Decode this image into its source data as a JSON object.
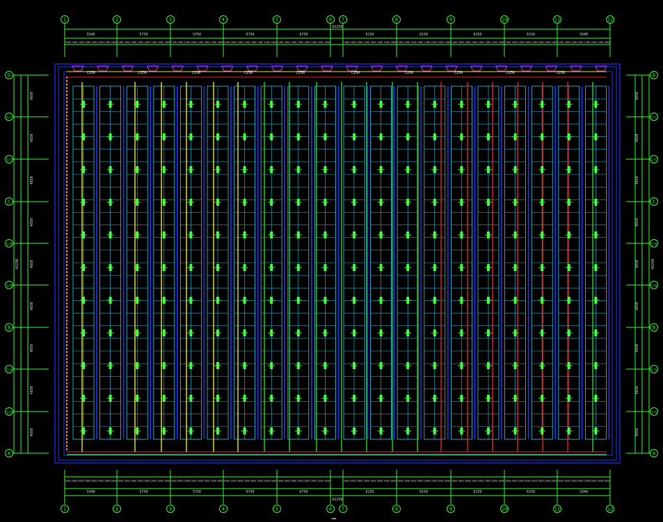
{
  "drawing": {
    "background": "#000000",
    "colors": {
      "axis": "#33ff33",
      "wall": "#2233ff",
      "rack": "#33ccee",
      "sprinkler": "#44ff44",
      "pipe_yellow": "#eeee22",
      "pipe_green": "#22dd22",
      "pipe_red": "#ee2222",
      "pipe_orange": "#ff8822",
      "magenta": "#dd22ee",
      "dim": "#dddddd",
      "label": "#ffffff"
    },
    "column_axes": [
      "1",
      "2",
      "3",
      "4",
      "5",
      "6",
      "7",
      "8",
      "9",
      "10",
      "11",
      "12"
    ],
    "row_axes": [
      "D",
      "2/C",
      "1/C",
      "C",
      "2/B",
      "1/B",
      "B",
      "2/A",
      "1/A",
      "A"
    ],
    "bay_dims_top": [
      "3340",
      "5750",
      "5750",
      "6750",
      "6750",
      "6150",
      "6150",
      "6150",
      "6150",
      "3340"
    ],
    "bay_dims_bottom": [
      "3340",
      "5750",
      "5750",
      "6750",
      "6750",
      "6150",
      "6150",
      "6150",
      "6150",
      "3340"
    ],
    "overall_width": "62250",
    "row_dims_left": [
      "4850",
      "4850",
      "4850",
      "4850",
      "4850",
      "4850",
      "4850",
      "4850",
      "4850"
    ],
    "overall_height": "45250",
    "rack_count": 20,
    "shelf_levels": 28,
    "top_labels": [
      "C250",
      "C250",
      "C250",
      "C250",
      "C250",
      "C250",
      "C250",
      "C250",
      "C250",
      "C250"
    ],
    "title": "…"
  }
}
